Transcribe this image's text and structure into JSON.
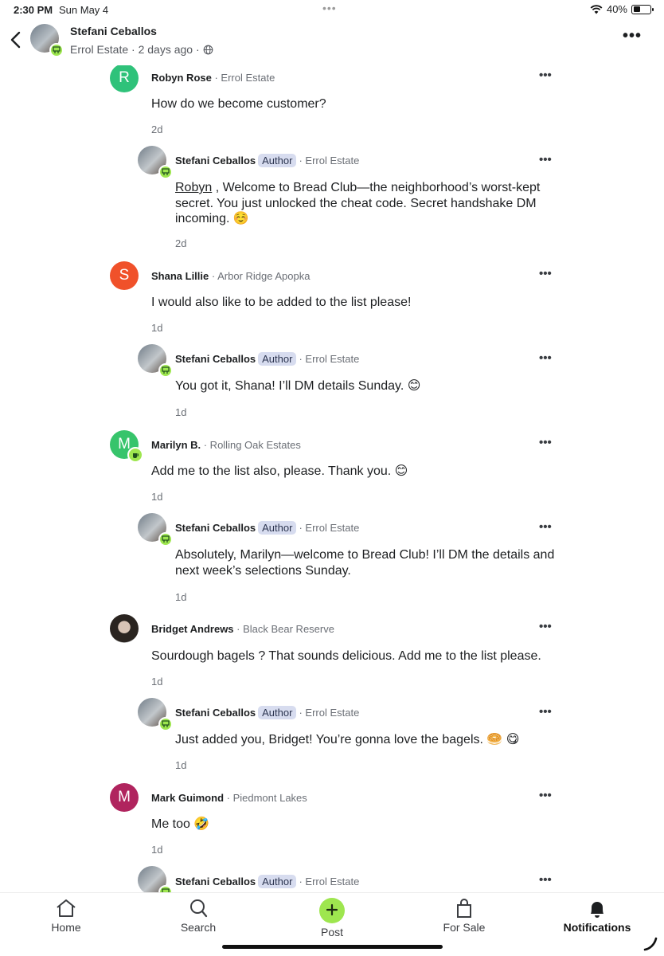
{
  "status_bar": {
    "time": "2:30 PM",
    "date": "Sun May 4",
    "battery": "40%",
    "battery_level": 0.4
  },
  "header": {
    "author_name": "Stefani Ceballos",
    "meta": "Errol Estate · 2 days ago ·",
    "icons": {
      "back": "chevron-left-icon",
      "privacy": "globe-icon",
      "more": "more-horizontal-icon"
    }
  },
  "comments": [
    {
      "name": "Robyn Rose",
      "hood": " · Errol Estate",
      "text": "How do we become customer?",
      "time": "2d",
      "initial": "R",
      "avatar_color": "#2fc27a",
      "reply": {
        "name": "Stefani Ceballos",
        "author_label": "Author",
        "hood": "· Errol Estate",
        "mention": "Robyn",
        "text": " , Welcome to Bread Club—the neighborhood’s worst-kept secret. You just unlocked the cheat code. Secret handshake DM incoming. ☺️",
        "time": "2d"
      }
    },
    {
      "name": "Shana Lillie",
      "hood": " · Arbor Ridge Apopka",
      "text": "I would also like to be added to the list please!",
      "time": "1d",
      "initial": "S",
      "avatar_color": "#f0512a",
      "reply": {
        "name": "Stefani Ceballos",
        "author_label": "Author",
        "hood": "· Errol Estate",
        "text": "You got it, Shana! I’ll DM details Sunday. 😊",
        "time": "1d"
      }
    },
    {
      "name": "Marilyn B.",
      "hood": " · Rolling Oak Estates",
      "text": "Add me to the list also, please. Thank you. 😊",
      "time": "1d",
      "initial": "M",
      "avatar_color": "#37c46b",
      "reply": {
        "name": "Stefani Ceballos",
        "author_label": "Author",
        "hood": "· Errol Estate",
        "text": "Absolutely, Marilyn—welcome to Bread Club! I’ll DM the details and next week’s selections Sunday.",
        "time": "1d"
      }
    },
    {
      "name": "Bridget Andrews",
      "hood": " · Black Bear Reserve",
      "text": "Sourdough bagels ? That sounds delicious. Add me to the list please.",
      "time": "1d",
      "initial": "",
      "avatar_color": "#333333",
      "reply": {
        "name": "Stefani Ceballos",
        "author_label": "Author",
        "hood": "· Errol Estate",
        "text": "Just added you, Bridget! You’re gonna love the bagels. 🥯 😋",
        "time": "1d"
      }
    },
    {
      "name": "Mark Guimond",
      "hood": " · Piedmont Lakes",
      "text": "Me too 🤣",
      "time": "1d",
      "initial": "M",
      "avatar_color": "#b0245e",
      "reply": {
        "name": "Stefani Ceballos",
        "author_label": "Author",
        "hood": "· Errol Estate",
        "text": "",
        "time": ""
      }
    }
  ],
  "tabbar": {
    "home": "Home",
    "search": "Search",
    "post": "Post",
    "for_sale": "For Sale",
    "notifications": "Notifications",
    "active": "notifications",
    "icons": [
      "home-icon",
      "search-icon",
      "plus-icon",
      "shopping-bag-icon",
      "bell-icon"
    ]
  },
  "colors": {
    "accent_green": "#9ee64f",
    "author_pill": "#d7dcef",
    "muted_text": "#6b6f76"
  }
}
